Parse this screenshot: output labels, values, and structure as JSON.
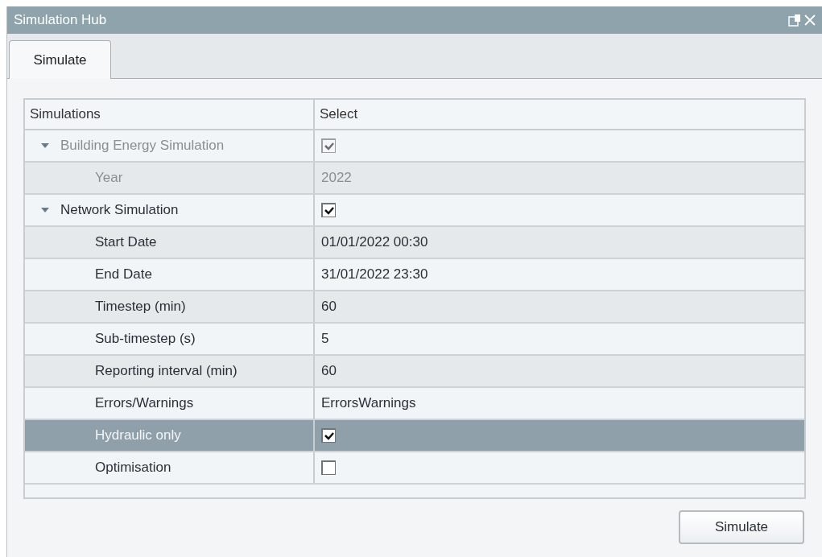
{
  "window": {
    "title": "Simulation Hub"
  },
  "tabs": [
    {
      "label": "Simulate",
      "selected": true
    }
  ],
  "table": {
    "columns": [
      "Simulations",
      "Select"
    ],
    "rows": [
      {
        "label": "Building Energy Simulation",
        "kind": "checkbox",
        "checked": true,
        "expanded": true,
        "disabled": true,
        "selected": false,
        "children": [
          {
            "label": "Year",
            "kind": "text",
            "value": "2022",
            "disabled": true,
            "selected": false
          }
        ]
      },
      {
        "label": "Network Simulation",
        "kind": "checkbox",
        "checked": true,
        "expanded": true,
        "disabled": false,
        "selected": false,
        "children": [
          {
            "label": "Start Date",
            "kind": "text",
            "value": "01/01/2022 00:30",
            "disabled": false,
            "selected": false
          },
          {
            "label": "End Date",
            "kind": "text",
            "value": "31/01/2022 23:30",
            "disabled": false,
            "selected": false
          },
          {
            "label": "Timestep (min)",
            "kind": "text",
            "value": "60",
            "disabled": false,
            "selected": false
          },
          {
            "label": "Sub-timestep (s)",
            "kind": "text",
            "value": "5",
            "disabled": false,
            "selected": false
          },
          {
            "label": "Reporting interval (min)",
            "kind": "text",
            "value": "60",
            "disabled": false,
            "selected": false
          },
          {
            "label": "Errors/Warnings",
            "kind": "text",
            "value": "ErrorsWarnings",
            "disabled": false,
            "selected": false
          },
          {
            "label": "Hydraulic only",
            "kind": "checkbox",
            "checked": true,
            "disabled": false,
            "selected": true
          },
          {
            "label": "Optimisation",
            "kind": "checkbox",
            "checked": false,
            "disabled": false,
            "selected": false
          }
        ]
      }
    ]
  },
  "button": "Simulate"
}
